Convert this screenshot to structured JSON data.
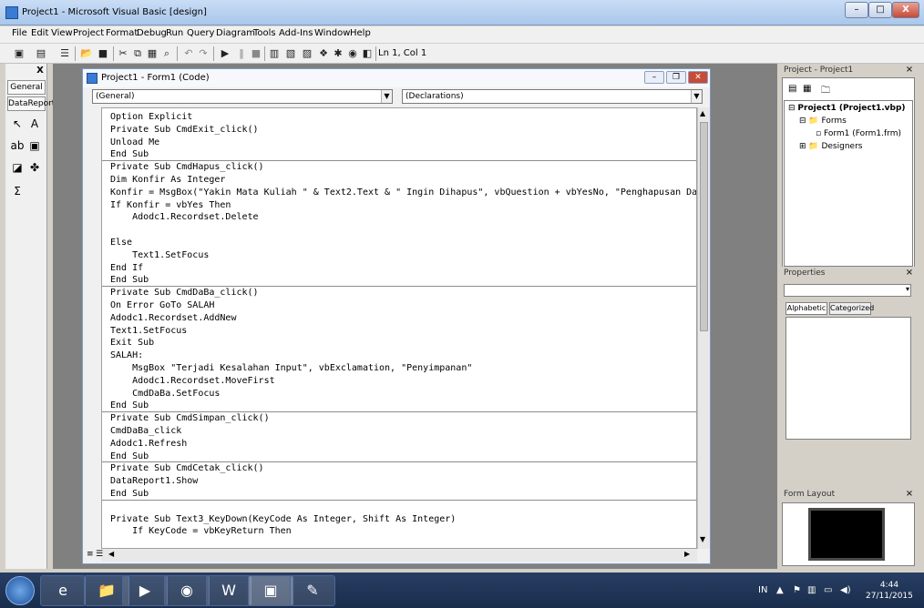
{
  "window": {
    "title": "Project1 - Microsoft Visual Basic [design]",
    "min": "–",
    "max": "□",
    "close": "X"
  },
  "menu": [
    "File",
    "Edit",
    "View",
    "Project",
    "Format",
    "Debug",
    "Run",
    "Query",
    "Diagram",
    "Tools",
    "Add-Ins",
    "Window",
    "Help"
  ],
  "toolbar": {
    "position": "Ln 1, Col 1"
  },
  "toolbox": {
    "tab1": "General",
    "tab2": "DataReport",
    "close": "X"
  },
  "code_window": {
    "title": "Project1 - Form1 (Code)",
    "object_combo": "(General)",
    "proc_combo": "(Declarations)",
    "lines": [
      "Option Explicit",
      "Private Sub CmdExit_click()",
      "Unload Me",
      "End Sub",
      "Private Sub CmdHapus_click()",
      "Dim Konfir As Integer",
      "Konfir = MsgBox(\"Yakin Mata Kuliah \" & Text2.Text & \" Ingin Dihapus\", vbQuestion + vbYesNo, \"Penghapusan Data",
      "If Konfir = vbYes Then",
      "    Adodc1.Recordset.Delete",
      "",
      "Else",
      "    Text1.SetFocus",
      "End If",
      "End Sub",
      "Private Sub CmdDaBa_click()",
      "On Error GoTo SALAH",
      "Adodc1.Recordset.AddNew",
      "Text1.SetFocus",
      "Exit Sub",
      "SALAH:",
      "    MsgBox \"Terjadi Kesalahan Input\", vbExclamation, \"Penyimpanan\"",
      "    Adodc1.Recordset.MoveFirst",
      "    CmdDaBa.SetFocus",
      "End Sub",
      "Private Sub CmdSimpan_click()",
      "CmdDaBa_click",
      "Adodc1.Refresh",
      "End Sub",
      "Private Sub CmdCetak_click()",
      "DataReport1.Show",
      "End Sub",
      "",
      "Private Sub Text3_KeyDown(KeyCode As Integer, Shift As Integer)",
      "    If KeyCode = vbKeyReturn Then"
    ]
  },
  "project_pane": {
    "title": "Project - Project1",
    "root": "Project1 (Project1.vbp)",
    "forms": "Forms",
    "form1": "Form1 (Form1.frm)",
    "designers": "Designers"
  },
  "properties_pane": {
    "title": "Properties",
    "tab1": "Alphabetic",
    "tab2": "Categorized"
  },
  "form_layout": {
    "title": "Form Layout"
  },
  "taskbar": {
    "time": "4:44",
    "date": "27/11/2015",
    "lang": "IN"
  }
}
